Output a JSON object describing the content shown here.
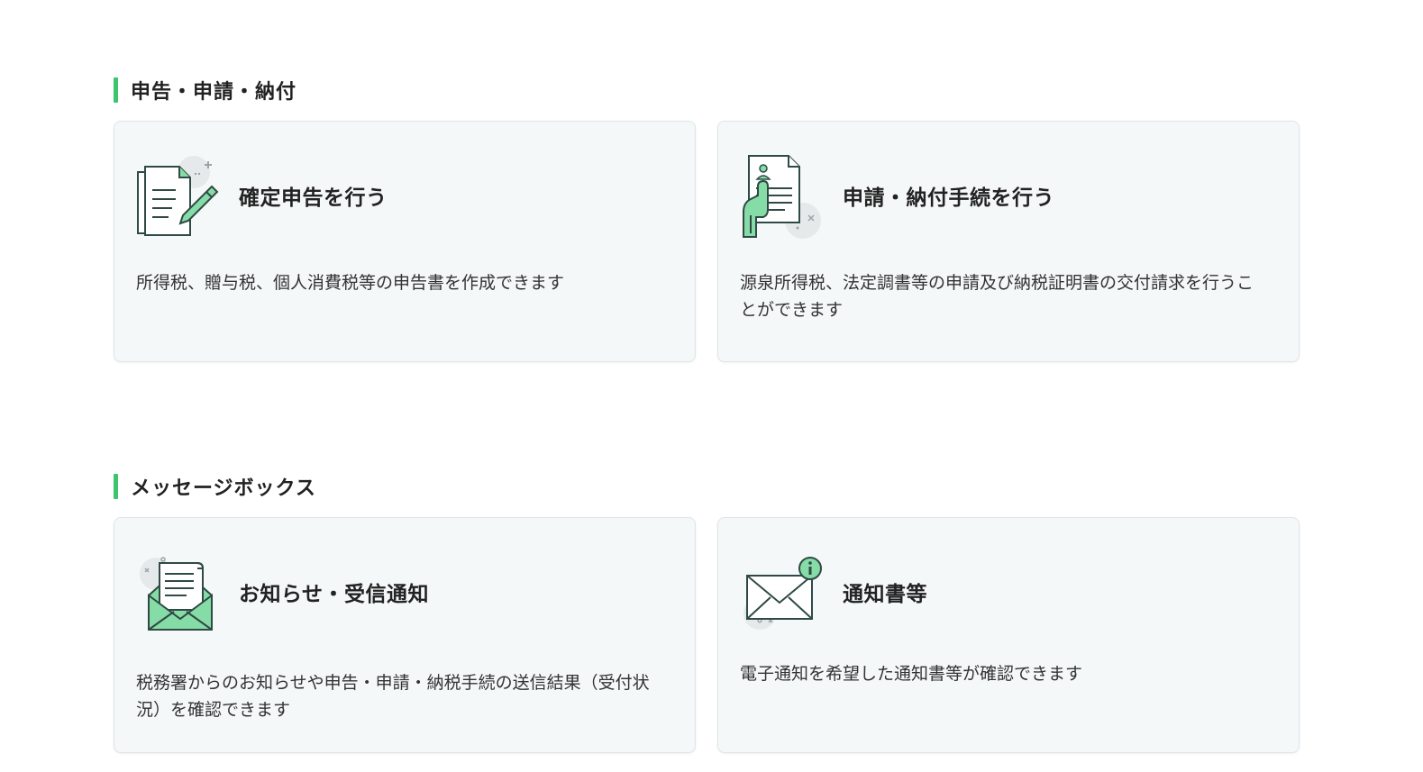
{
  "sections": [
    {
      "heading": "申告・申請・納付",
      "cards": [
        {
          "title": "確定申告を行う",
          "description": "所得税、贈与税、個人消費税等の申告書を作成できます",
          "icon": "document-pencil-icon"
        },
        {
          "title": "申請・納付手続を行う",
          "description": "源泉所得税、法定調書等の申請及び納税証明書の交付請求を行うことができます",
          "icon": "hand-document-icon"
        }
      ]
    },
    {
      "heading": "メッセージボックス",
      "cards": [
        {
          "title": "お知らせ・受信通知",
          "description": "税務署からのお知らせや申告・申請・納税手続の送信結果（受付状況）を確認できます",
          "icon": "open-envelope-letter-icon"
        },
        {
          "title": "通知書等",
          "description": "電子通知を希望した通知書等が確認できます",
          "icon": "envelope-info-icon"
        }
      ]
    }
  ],
  "colors": {
    "accent": "#3cc46f",
    "icon_green": "#86dca6",
    "icon_stroke": "#2f4a45",
    "card_bg": "#f5f8f9"
  }
}
